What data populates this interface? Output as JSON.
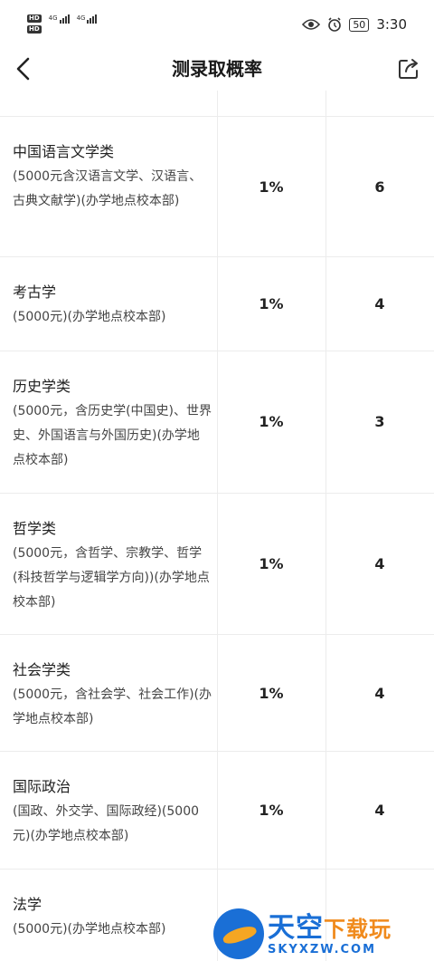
{
  "status_bar": {
    "hd1": "HD",
    "hd2": "HD",
    "net1": "4G",
    "net2": "4G",
    "battery": "50",
    "time": "3:30"
  },
  "header": {
    "title": "测录取概率",
    "back_icon": "chevron-left-icon",
    "share_icon": "share-icon"
  },
  "rows": [
    {
      "name": "中国语言文学类",
      "detail": "(5000元含汉语言文学、汉语言、古典文献学)(办学地点校本部)",
      "probability": "1%",
      "count": "6"
    },
    {
      "name": "考古学",
      "detail": "(5000元)(办学地点校本部)",
      "probability": "1%",
      "count": "4"
    },
    {
      "name": "历史学类",
      "detail": "(5000元，含历史学(中国史)、世界史、外国语言与外国历史)(办学地点校本部)",
      "probability": "1%",
      "count": "3"
    },
    {
      "name": "哲学类",
      "detail": "(5000元，含哲学、宗教学、哲学(科技哲学与逻辑学方向))(办学地点校本部)",
      "probability": "1%",
      "count": "4"
    },
    {
      "name": "社会学类",
      "detail": "(5000元，含社会学、社会工作)(办学地点校本部)",
      "probability": "1%",
      "count": "4"
    },
    {
      "name": "国际政治",
      "detail": "(国政、外交学、国际政经)(5000元)(办学地点校本部)",
      "probability": "1%",
      "count": "4"
    },
    {
      "name": "法学",
      "detail": "(5000元)(办学地点校本部)",
      "probability": "",
      "count": ""
    }
  ],
  "watermark": {
    "title_main": "天空",
    "title_accent": "下载玩",
    "url": "SKYXZW.COM"
  }
}
